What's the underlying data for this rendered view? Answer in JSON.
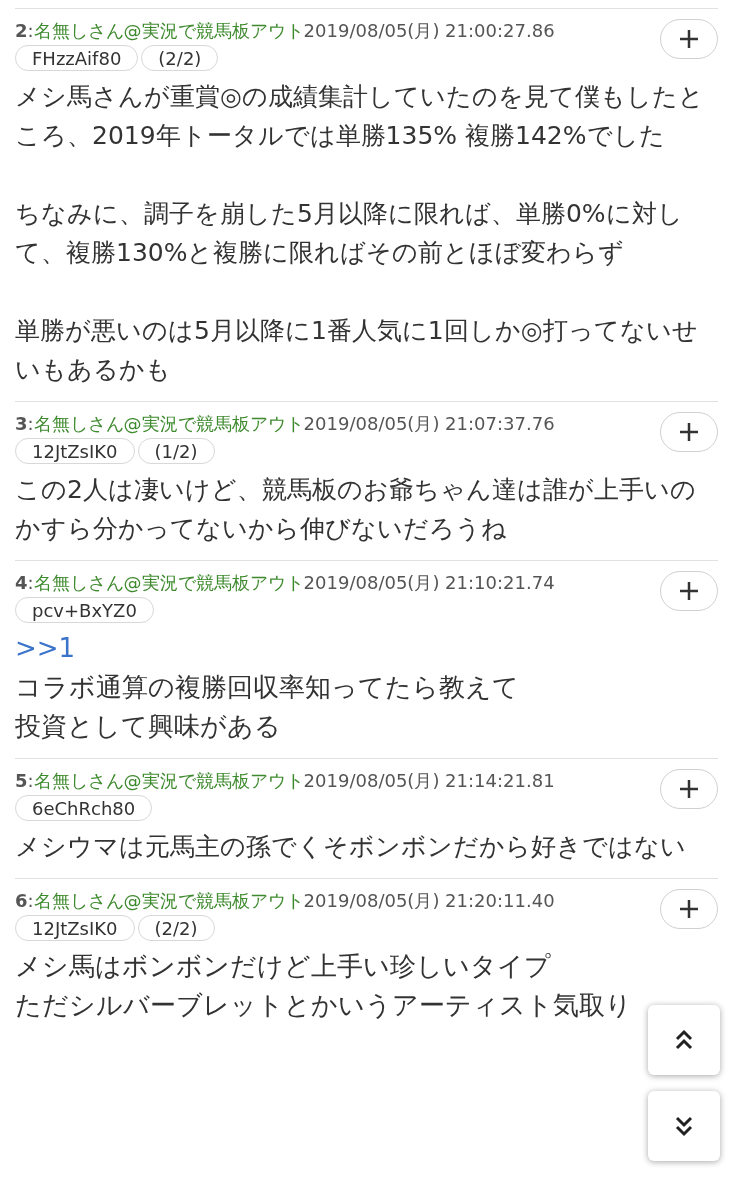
{
  "posts": [
    {
      "number": "2",
      "separator": ":",
      "name": "名無しさん@実況で競馬板アウト",
      "date": "2019/08/05(月) 21:00:27.86",
      "id": "FHzzAif80",
      "count": "(2/2)",
      "body": [
        {
          "kind": "text",
          "text": "メシ馬さんが重賞◎の成績集計していたのを見て僕もしたところ、2019年トータルでは単勝135% 複勝142%でした"
        },
        {
          "kind": "text",
          "text": "ちなみに、調子を崩した5月以降に限れば、単勝0%に対して、複勝130%と複勝に限ればその前とほぼ変わらず"
        },
        {
          "kind": "text",
          "text": "単勝が悪いのは5月以降に1番人気に1回しか◎打ってないせいもあるかも"
        }
      ]
    },
    {
      "number": "3",
      "separator": ":",
      "name": "名無しさん@実況で競馬板アウト",
      "date": "2019/08/05(月) 21:07:37.76",
      "id": "12JtZsIK0",
      "count": "(1/2)",
      "body": [
        {
          "kind": "text",
          "text": "この2人は凄いけど、競馬板のお爺ちゃん達は誰が上手いのかすら分かってないから伸びないだろうね"
        }
      ]
    },
    {
      "number": "4",
      "separator": ":",
      "name": "名無しさん@実況で競馬板アウト",
      "date": "2019/08/05(月) 21:10:21.74",
      "id": "pcv+BxYZ0",
      "body": [
        {
          "kind": "anchor",
          "text": ">>1"
        },
        {
          "kind": "line",
          "text": "コラボ通算の複勝回収率知ってたら教えて"
        },
        {
          "kind": "line",
          "text": "投資として興味がある"
        }
      ]
    },
    {
      "number": "5",
      "separator": ":",
      "name": "名無しさん@実況で競馬板アウト",
      "date": "2019/08/05(月) 21:14:21.81",
      "id": "6eChRch80",
      "body": [
        {
          "kind": "text",
          "text": "メシウマは元馬主の孫でくそボンボンだから好きではない"
        }
      ]
    },
    {
      "number": "6",
      "separator": ":",
      "name": "名無しさん@実況で競馬板アウト",
      "date": "2019/08/05(月) 21:20:11.40",
      "id": "12JtZsIK0",
      "count": "(2/2)",
      "body": [
        {
          "kind": "line",
          "text": "メシ馬はボンボンだけど上手い珍しいタイプ"
        },
        {
          "kind": "line",
          "text": "ただシルバーブレットとかいうアーティスト気取り"
        }
      ]
    }
  ]
}
